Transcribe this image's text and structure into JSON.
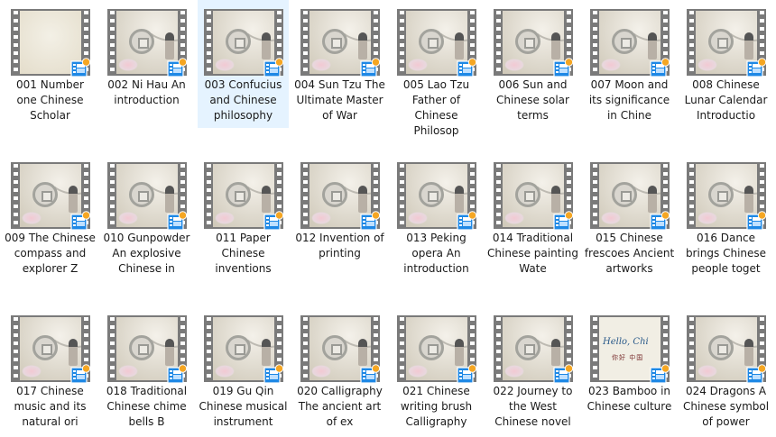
{
  "items": [
    {
      "caption": "001 Number one Chinese Scholar",
      "thumb": "plain"
    },
    {
      "caption": "002 Ni Hau An introduction",
      "thumb": "scholar"
    },
    {
      "caption": "003 Confucius and Chinese philosophy",
      "thumb": "scholar",
      "selected": true
    },
    {
      "caption": "004 Sun Tzu The Ultimate Master of War",
      "thumb": "scholar"
    },
    {
      "caption": "005 Lao Tzu Father of Chinese Philosop",
      "thumb": "scholar"
    },
    {
      "caption": "006 Sun and Chinese solar terms",
      "thumb": "scholar"
    },
    {
      "caption": "007 Moon and its significance in Chine",
      "thumb": "scholar"
    },
    {
      "caption": "008 Chinese Lunar Calendar Introductio",
      "thumb": "scholar"
    },
    {
      "caption": "009 The Chinese compass and explorer Z",
      "thumb": "scholar"
    },
    {
      "caption": "010 Gunpowder An explosive Chinese in",
      "thumb": "scholar"
    },
    {
      "caption": "011 Paper Chinese inventions",
      "thumb": "scholar"
    },
    {
      "caption": "012 Invention of printing",
      "thumb": "scholar"
    },
    {
      "caption": "013 Peking opera An introduction",
      "thumb": "scholar"
    },
    {
      "caption": "014 Traditional Chinese painting Wate",
      "thumb": "scholar"
    },
    {
      "caption": "015 Chinese frescoes Ancient artworks",
      "thumb": "scholar"
    },
    {
      "caption": "016 Dance brings Chinese people toget",
      "thumb": "scholar"
    },
    {
      "caption": "017 Chinese music and its natural ori",
      "thumb": "scholar"
    },
    {
      "caption": "018 Traditional Chinese chime bells B",
      "thumb": "scholar"
    },
    {
      "caption": "019 Gu Qin Chinese musical instrument",
      "thumb": "scholar"
    },
    {
      "caption": "020 Calligraphy The ancient art of ex",
      "thumb": "scholar"
    },
    {
      "caption": "021 Chinese writing brush Calligraphy",
      "thumb": "scholar"
    },
    {
      "caption": "022 Journey to the West Chinese novel",
      "thumb": "scholar"
    },
    {
      "caption": "023 Bamboo in Chinese culture",
      "thumb": "hello",
      "thumb_text": "Hello, Chi",
      "thumb_subtext": "你好 中国"
    },
    {
      "caption": "024 Dragons A Chinese symbol of power",
      "thumb": "scholar"
    }
  ],
  "colors": {
    "selection": "#e5f3ff",
    "badge_blue": "#1e88e5",
    "badge_orange": "#f5a623"
  },
  "icons": {
    "file_type": "video-file-icon",
    "overlay": "video-badge-icon"
  }
}
